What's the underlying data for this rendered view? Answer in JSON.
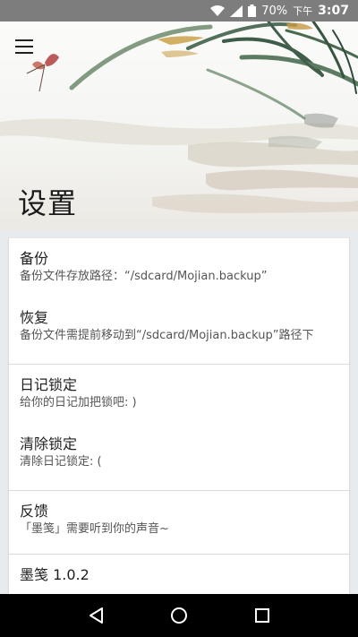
{
  "status": {
    "battery": "70%",
    "ampm": "下午",
    "time": "3:07"
  },
  "header": {
    "title": "设置"
  },
  "settings": {
    "backup": {
      "title": "备份",
      "subtitle": "备份文件存放路径：“/sdcard/Mojian.backup”"
    },
    "restore": {
      "title": "恢复",
      "subtitle": "备份文件需提前移动到“/sdcard/Mojian.backup”路径下"
    },
    "diary_lock": {
      "title": "日记锁定",
      "subtitle": "给你的日记加把锁吧: )"
    },
    "clear_lock": {
      "title": "清除锁定",
      "subtitle": "清除日记锁定: ("
    },
    "feedback": {
      "title": "反馈",
      "subtitle": "「墨笺」需要听到你的声音~"
    },
    "version": {
      "title": "墨笺 1.0.2"
    }
  },
  "nav": {
    "back": "back-icon",
    "home": "home-icon",
    "recents": "recents-icon"
  }
}
